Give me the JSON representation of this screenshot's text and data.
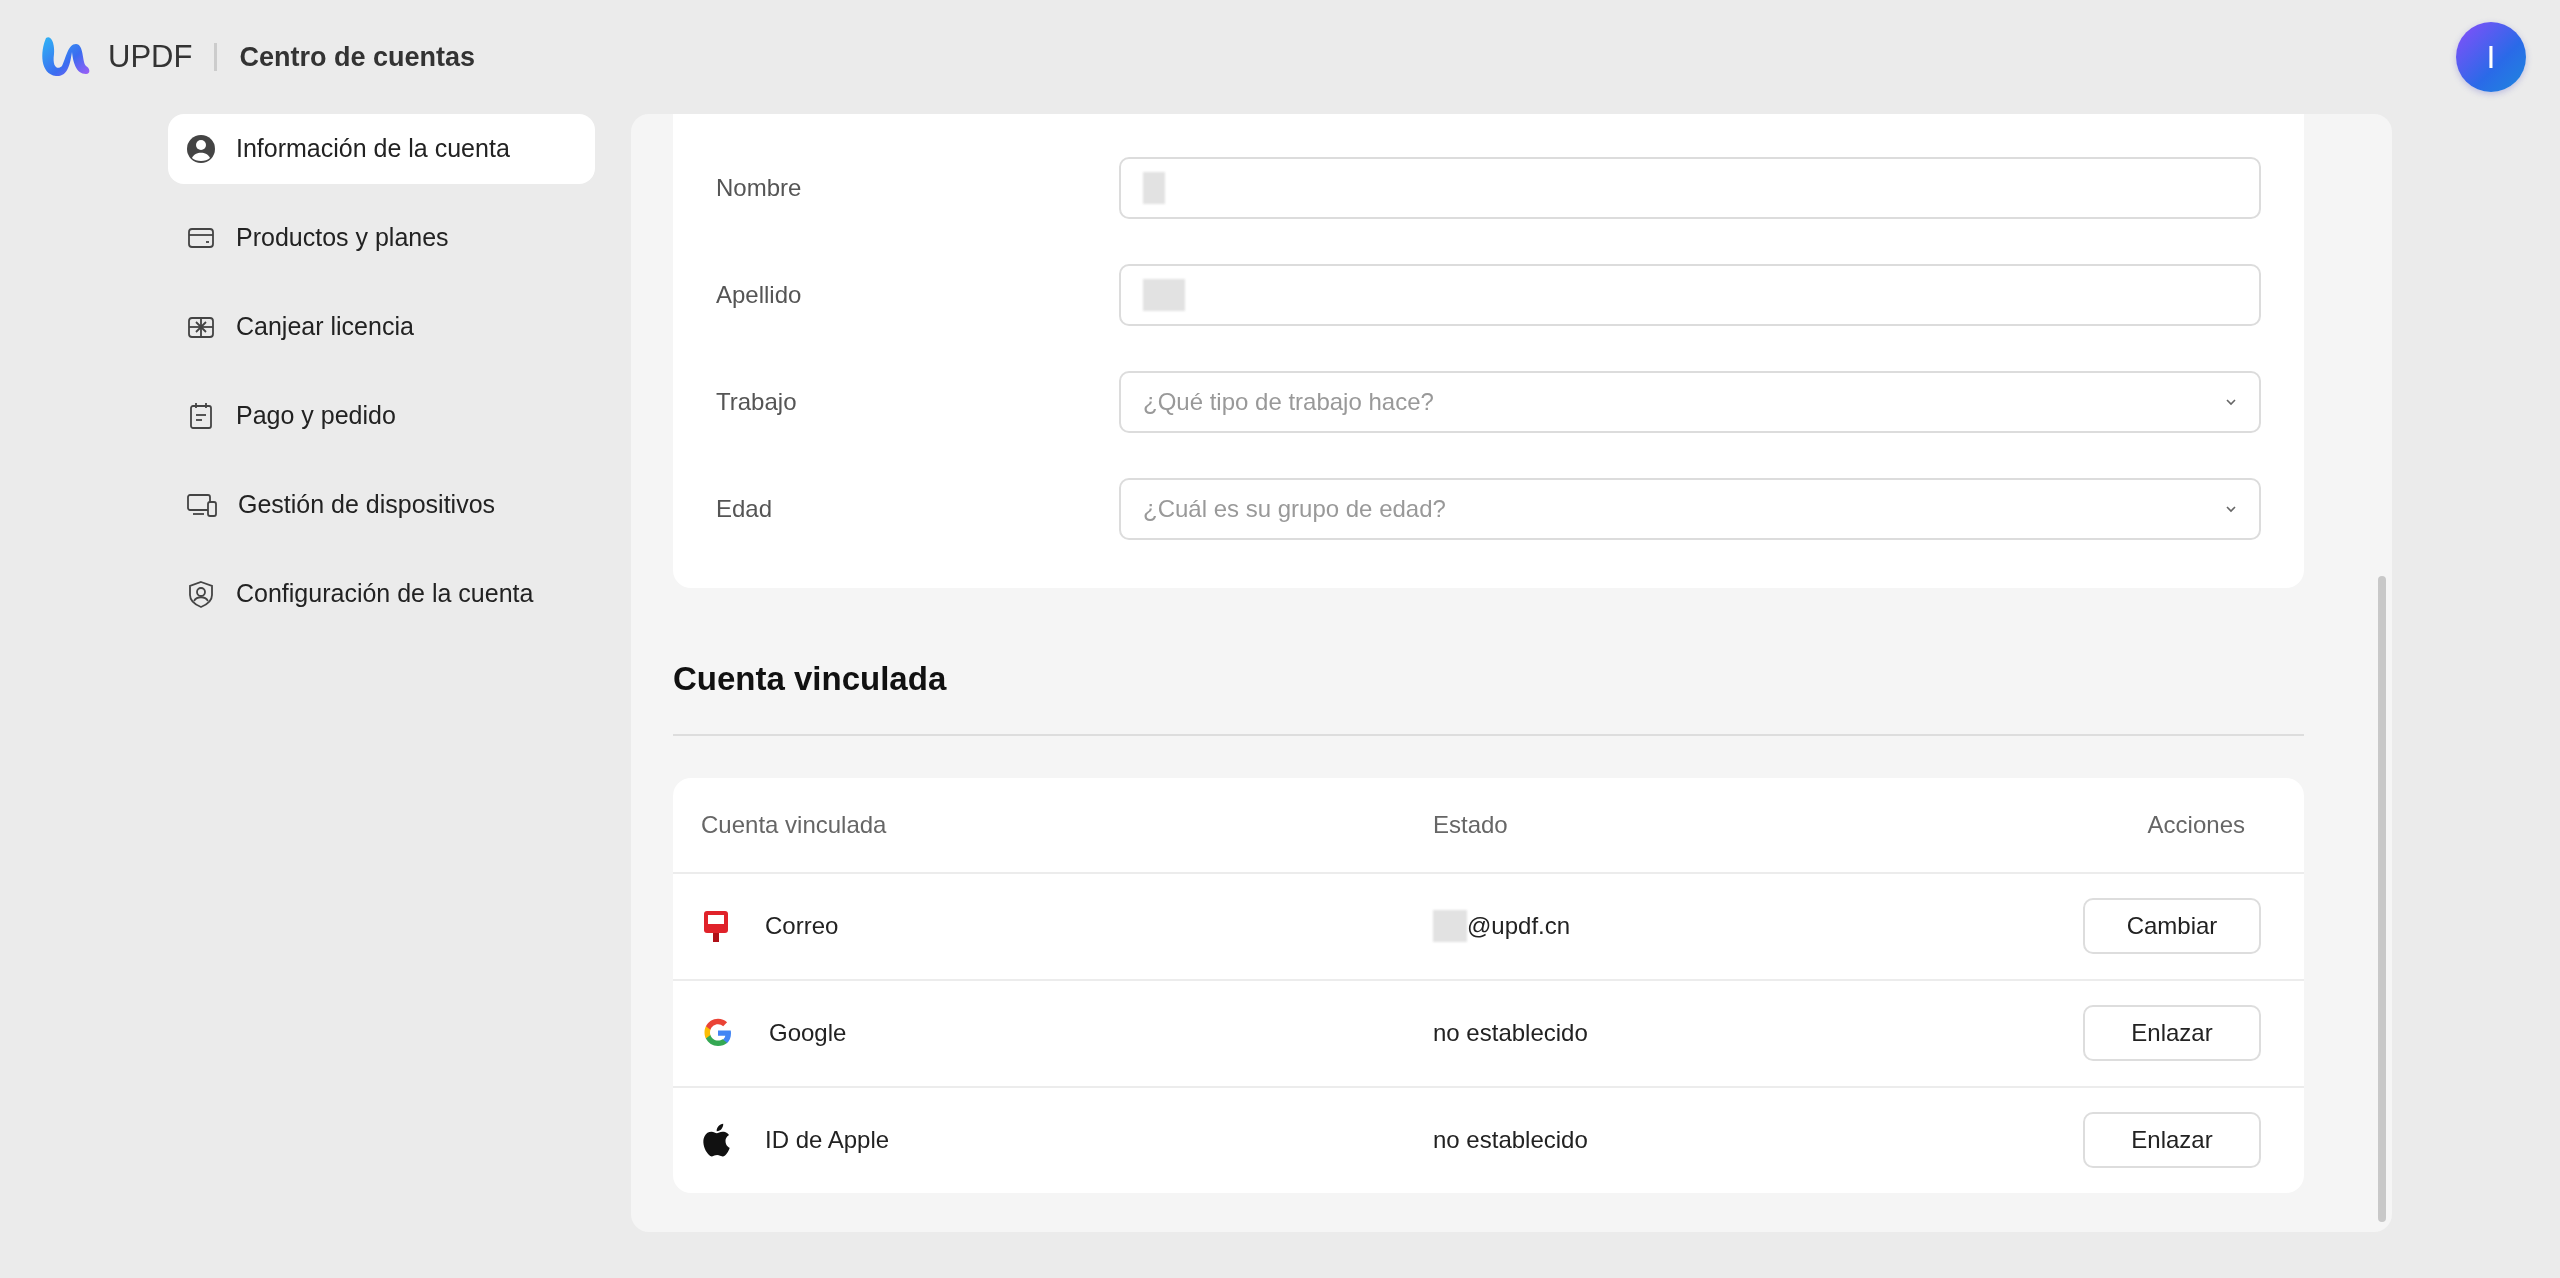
{
  "header": {
    "brand": "UPDF",
    "title": "Centro de cuentas",
    "avatar_initial": "I"
  },
  "sidebar": {
    "items": [
      {
        "label": "Información de la cuenta",
        "selected": true
      },
      {
        "label": "Productos y planes",
        "selected": false
      },
      {
        "label": "Canjear licencia",
        "selected": false
      },
      {
        "label": "Pago y pedido",
        "selected": false
      },
      {
        "label": "Gestión de dispositivos",
        "selected": false
      },
      {
        "label": "Configuración de la cuenta",
        "selected": false
      }
    ]
  },
  "profile_form": {
    "fields": [
      {
        "label": "Nombre",
        "kind": "text",
        "redacted": true
      },
      {
        "label": "Apellido",
        "kind": "text",
        "redacted": true
      },
      {
        "label": "Trabajo",
        "kind": "select",
        "placeholder": "¿Qué tipo de trabajo hace?"
      },
      {
        "label": "Edad",
        "kind": "select",
        "placeholder": "¿Cuál es su grupo de edad?"
      }
    ]
  },
  "linked_accounts": {
    "heading": "Cuenta vinculada",
    "columns": [
      "Cuenta vinculada",
      "Estado",
      "Acciones"
    ],
    "rows": [
      {
        "service": "Correo",
        "status": "@updf.cn",
        "status_redacted": true,
        "action": "Cambiar"
      },
      {
        "service": "Google",
        "status": "no establecido",
        "status_redacted": false,
        "action": "Enlazar"
      },
      {
        "service": "ID de Apple",
        "status": "no establecido",
        "status_redacted": false,
        "action": "Enlazar"
      }
    ]
  }
}
